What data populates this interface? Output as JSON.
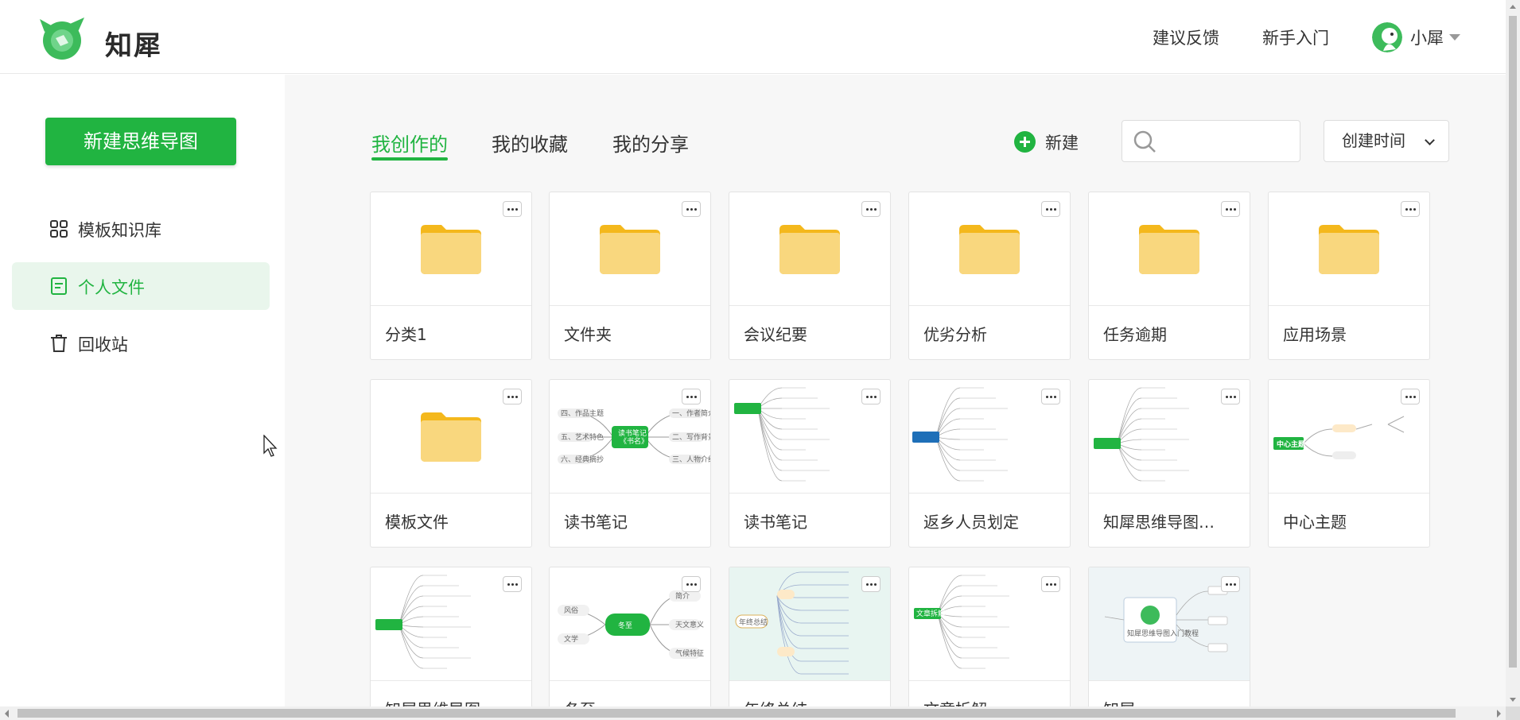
{
  "header": {
    "brand": "知犀",
    "links": [
      "建议反馈",
      "新手入门"
    ],
    "user_name": "小犀"
  },
  "sidebar": {
    "new_button": "新建思维导图",
    "items": [
      {
        "label": "模板知识库",
        "icon": "grid-icon",
        "active": false
      },
      {
        "label": "个人文件",
        "icon": "document-icon",
        "active": true
      },
      {
        "label": "回收站",
        "icon": "trash-icon",
        "active": false
      }
    ]
  },
  "tabs": [
    {
      "label": "我创作的",
      "active": true
    },
    {
      "label": "我的收藏",
      "active": false
    },
    {
      "label": "我的分享",
      "active": false
    }
  ],
  "toolbar": {
    "new_label": "新建",
    "search_placeholder": "",
    "sort_label": "创建时间"
  },
  "cards": [
    {
      "title": "分类1",
      "kind": "folder"
    },
    {
      "title": "文件夹",
      "kind": "folder"
    },
    {
      "title": "会议纪要",
      "kind": "folder"
    },
    {
      "title": "优劣分析",
      "kind": "folder"
    },
    {
      "title": "任务逾期",
      "kind": "folder"
    },
    {
      "title": "应用场景",
      "kind": "folder"
    },
    {
      "title": "模板文件",
      "kind": "folder"
    },
    {
      "title": "读书笔记",
      "kind": "map"
    },
    {
      "title": "读书笔记",
      "kind": "map"
    },
    {
      "title": "返乡人员划定",
      "kind": "map"
    },
    {
      "title": "知犀思维导图…",
      "kind": "map"
    },
    {
      "title": "中心主题",
      "kind": "map"
    },
    {
      "title": "知犀思维导图",
      "kind": "map"
    },
    {
      "title": "冬至",
      "kind": "map"
    },
    {
      "title": "年终总结",
      "kind": "map"
    },
    {
      "title": "文章拆解",
      "kind": "map"
    },
    {
      "title": "知犀",
      "kind": "map"
    }
  ],
  "thumbs": {
    "book_center": "读书笔记\n《书名》",
    "book_nodes": [
      "四、作品主题",
      "五、艺术特色",
      "六、经典摘抄",
      "一、作者简介",
      "二、写作背景",
      "三、人物介绍"
    ],
    "center_topic": "中心主题",
    "winter_center": "冬至",
    "winter_nodes": [
      "风俗",
      "文学",
      "简介",
      "天文意义",
      "气候特征"
    ],
    "year_center": "年终总结",
    "article_center": "文章拆解",
    "zhixi_map_title": "知犀思维导图入门教程"
  },
  "colors": {
    "accent": "#21b441",
    "folder": "#f9d77e",
    "folder_tab": "#f4b81c"
  }
}
